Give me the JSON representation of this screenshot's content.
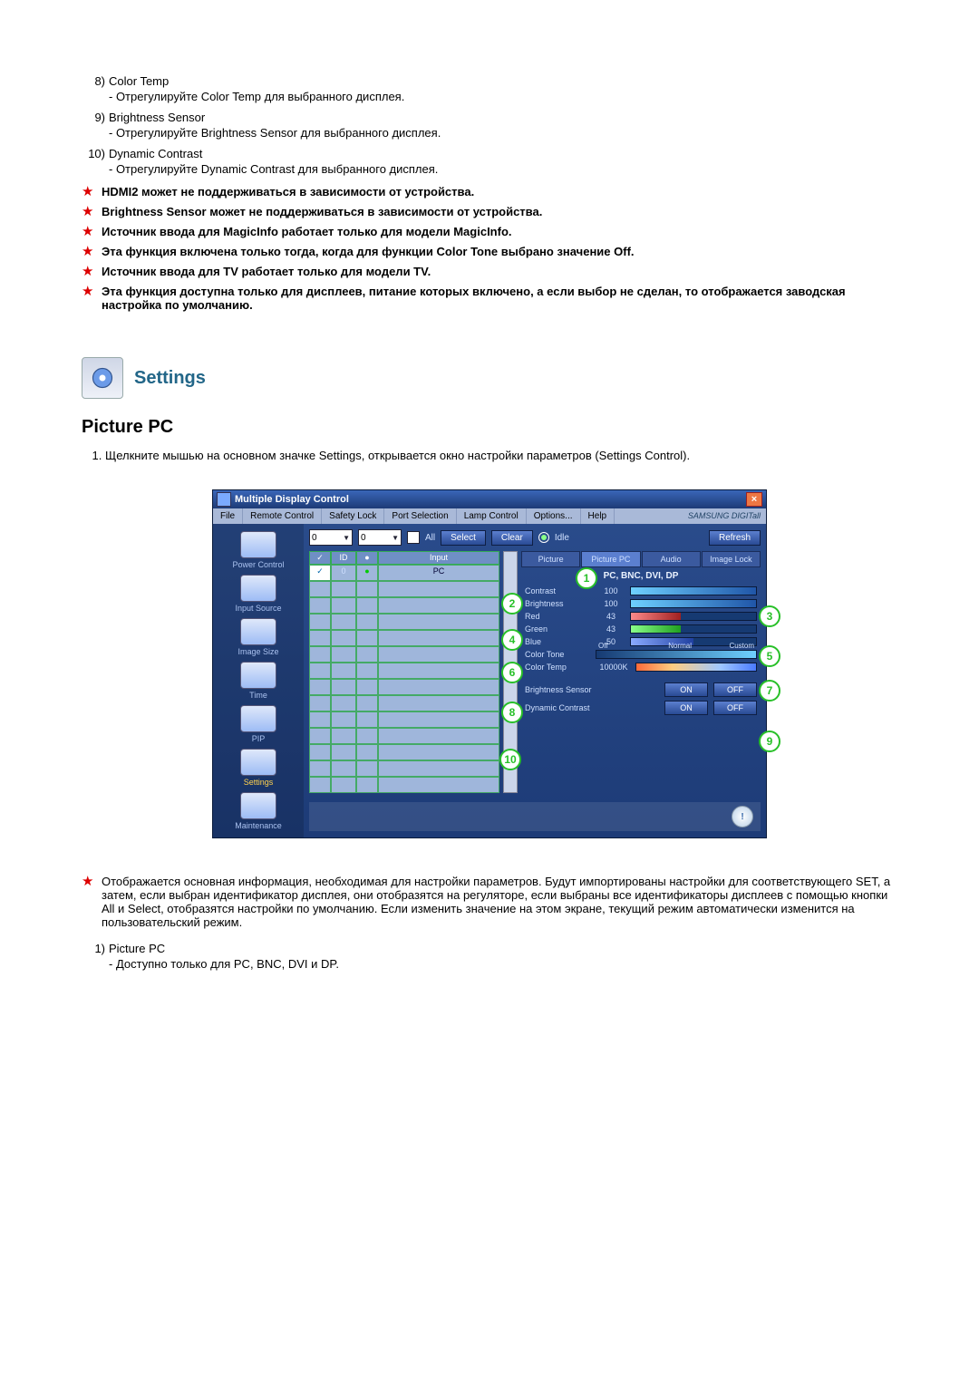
{
  "list_top": [
    {
      "n": "8)",
      "title": "Color Temp",
      "sub": "- Отрегулируйте Color Temp для выбранного дисплея."
    },
    {
      "n": "9)",
      "title": "Brightness Sensor",
      "sub": "- Отрегулируйте Brightness Sensor для выбранного дисплея."
    },
    {
      "n": "10)",
      "title": "Dynamic Contrast",
      "sub": "- Отрегулируйте Dynamic Contrast для выбранного дисплея."
    }
  ],
  "notes_top": [
    "HDMI2 может не поддерживаться в зависимости от устройства.",
    "Brightness Sensor может не поддерживаться в зависимости от устройства.",
    "Источник ввода для MagicInfo работает только для модели MagicInfo.",
    "Эта функция включена только тогда, когда для функции Color Tone выбрано значение Off.",
    "Источник ввода для TV работает только для модели TV.",
    "Эта функция доступна только для дисплеев, питание которых включено, а если выбор не сделан, то отображается заводская настройка по умолчанию."
  ],
  "settings_label": "Settings",
  "section_title": "Picture PC",
  "step1": "Щелкните мышью на основном значке Settings, открывается окно настройки параметров (Settings Control).",
  "app": {
    "title": "Multiple Display Control",
    "menu": [
      "File",
      "Remote Control",
      "Safety Lock",
      "Port Selection",
      "Lamp Control",
      "Options...",
      "Help"
    ],
    "brand": "SAMSUNG DIGITall",
    "sidebar": [
      {
        "label": "Power Control"
      },
      {
        "label": "Input Source"
      },
      {
        "label": "Image Size"
      },
      {
        "label": "Time"
      },
      {
        "label": "PIP"
      },
      {
        "label": "Settings",
        "active": true
      },
      {
        "label": "Maintenance"
      }
    ],
    "toolbar": {
      "dd1": "0",
      "dd2": "0",
      "all": "All",
      "select": "Select",
      "clear": "Clear",
      "idle": "Idle",
      "refresh": "Refresh"
    },
    "grid_head": {
      "c1": "",
      "c2": "ID",
      "c3": "",
      "c4": "Input"
    },
    "grid_row1": {
      "c2": "0",
      "c4": "PC"
    },
    "tabs": [
      "Picture",
      "Picture PC",
      "Audio",
      "Image Lock"
    ],
    "panel_title": "PC, BNC, DVI, DP",
    "rows": {
      "contrast": {
        "label": "Contrast",
        "val": "100"
      },
      "brightness": {
        "label": "Brightness",
        "val": "100"
      },
      "red": {
        "label": "Red",
        "val": "43"
      },
      "green": {
        "label": "Green",
        "val": "43"
      },
      "blue": {
        "label": "Blue",
        "val": "50"
      },
      "tone": {
        "label": "Color Tone",
        "off": "Off",
        "normal": "Normal",
        "custom": "Custom"
      },
      "temp": {
        "label": "Color Temp",
        "val": "10000K"
      },
      "bsensor": {
        "label": "Brightness Sensor",
        "on": "ON",
        "off": "OFF"
      },
      "dcontrast": {
        "label": "Dynamic Contrast",
        "on": "ON",
        "off": "OFF"
      }
    }
  },
  "note_bottom": "Отображается основная информация, необходимая для настройки параметров. Будут импортированы настройки для соответствующего SET, а затем, если выбран идентификатор дисплея, они отобразятся на регуляторе, если выбраны все идентификаторы дисплеев с помощью кнопки All и Select, отобразятся настройки по умолчанию. Если изменить значение на этом экране, текущий режим автоматически изменится на пользовательский режим.",
  "list_bottom": {
    "n": "1)",
    "title": "Picture PC",
    "sub": "- Доступно только для PC, BNC, DVI и DP."
  },
  "callout_nums": {
    "c1": "1",
    "c2": "2",
    "c3": "3",
    "c4": "4",
    "c5": "5",
    "c6": "6",
    "c7": "7",
    "c8": "8",
    "c9": "9",
    "c10": "10"
  }
}
